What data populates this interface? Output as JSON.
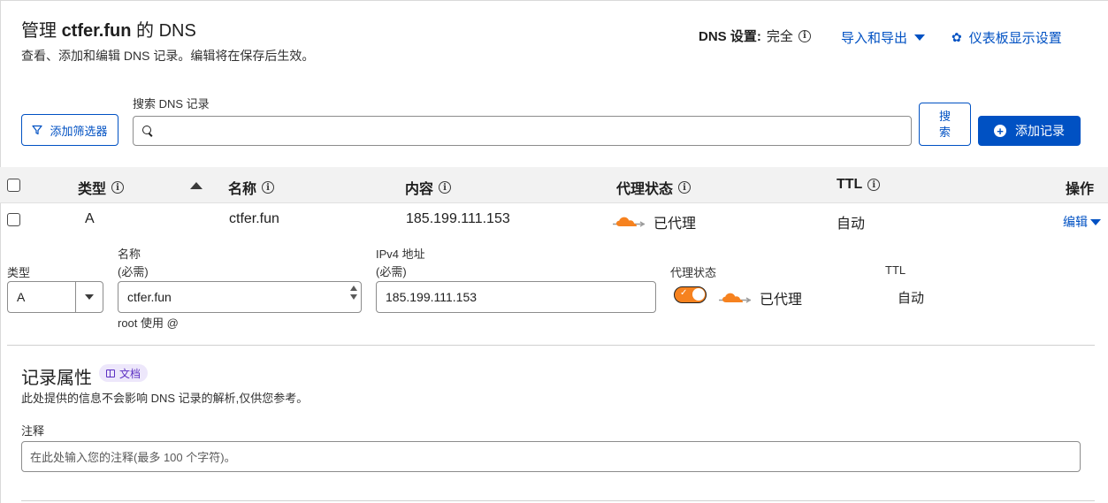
{
  "header": {
    "title_prefix": "管理 ",
    "title_domain": "ctfer.fun",
    "title_suffix": " 的 DNS",
    "subtitle": "查看、添加和编辑 DNS 记录。编辑将在保存后生效。",
    "dns_setting_label": "DNS 设置:",
    "dns_setting_value": "完全",
    "import_export": "导入和导出",
    "dashboard_settings": "仪表板显示设置"
  },
  "toolbar": {
    "add_filter": "添加筛选器",
    "search_label": "搜索 DNS 记录",
    "search_value": "",
    "search_button_line1": "搜",
    "search_button_line2": "索",
    "add_record": "添加记录"
  },
  "table": {
    "columns": {
      "type": "类型",
      "name": "名称",
      "content": "内容",
      "proxy": "代理状态",
      "ttl": "TTL",
      "actions": "操作"
    },
    "rows": [
      {
        "type": "A",
        "name": "ctfer.fun",
        "content": "185.199.111.153",
        "proxy": "已代理",
        "ttl": "自动",
        "action": "编辑"
      }
    ]
  },
  "editor": {
    "type_label": "类型",
    "type_value": "A",
    "name_label": "名称",
    "name_required": "(必需)",
    "name_value": "ctfer.fun",
    "name_hint": "root 使用 @",
    "ipv4_label": "IPv4 地址",
    "ipv4_required": "(必需)",
    "ipv4_value": "185.199.111.153",
    "proxy_label": "代理状态",
    "proxy_enabled": true,
    "proxy_value": "已代理",
    "ttl_label": "TTL",
    "ttl_value": "自动"
  },
  "attributes": {
    "title": "记录属性",
    "doc_badge": "文档",
    "description": "此处提供的信息不会影响 DNS 记录的解析,仅供您参考。",
    "note_label": "注释",
    "note_placeholder": "在此处输入您的注释(最多 100 个字符)。"
  },
  "colors": {
    "accent": "#0051c3",
    "cloud": "#f6821f",
    "header_bg": "#f2f2f2"
  }
}
